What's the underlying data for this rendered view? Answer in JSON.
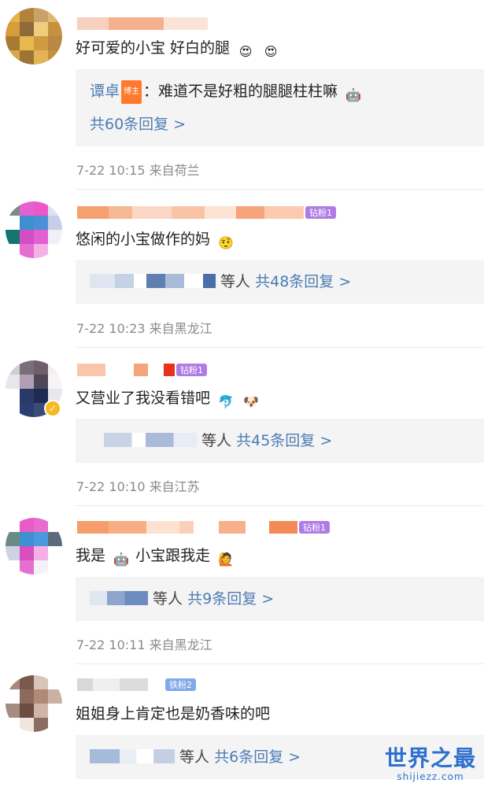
{
  "comments": [
    {
      "text": "好可爱的小宝 好白的腿",
      "emojis": [
        "😍",
        "😍"
      ],
      "reply": {
        "author": "谭卓",
        "author_tag": "博主",
        "text": "：难道不是好粗的腿腿柱柱嘛",
        "text_emoji": "🤖",
        "count_label": "共60条回复 >"
      },
      "meta": "7-22 10:15 来自荷兰"
    },
    {
      "text": "悠闲的小宝做作的妈",
      "emojis": [
        "🤨"
      ],
      "badge": "钻粉1",
      "replies_summary": {
        "others": "等人",
        "count_label": "共48条回复 >"
      },
      "meta": "7-22 10:23 来自黑龙江"
    },
    {
      "text": "又营业了我没看错吧",
      "emojis": [
        "🐬",
        "🐶"
      ],
      "badge": "钻粉1",
      "replies_summary": {
        "others": "等人",
        "count_label": "共45条回复 >"
      },
      "meta": "7-22 10:10 来自江苏"
    },
    {
      "text_before": "我是",
      "text_after": " 小宝跟我走",
      "emojis": [
        "🤖",
        "🙋"
      ],
      "badge": "钻粉1",
      "replies_summary": {
        "others": "等人",
        "count_label": "共9条回复 >"
      },
      "meta": "7-22 10:11 来自黑龙江"
    },
    {
      "text": "姐姐身上肯定也是奶香味的吧",
      "badge": "铁粉2",
      "replies_summary": {
        "others": "等人",
        "count_label": "共6条回复 >"
      }
    }
  ],
  "watermark": {
    "title": "世界之最",
    "url": "shijiezz.com"
  },
  "colors": {
    "link": "#4d7cb4",
    "meta": "#8a8a8a",
    "reply_bg": "#f4f4f4",
    "badge_purple": "#b07be6",
    "badge_blue": "#7fa9e8"
  }
}
